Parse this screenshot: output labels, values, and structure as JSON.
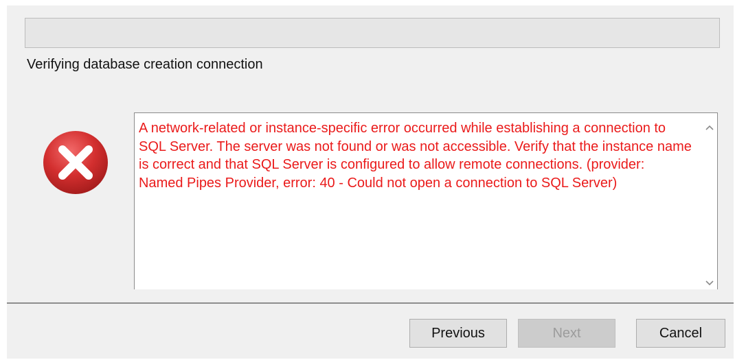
{
  "progress": {
    "value": 0
  },
  "status_text": "Verifying database creation connection",
  "error": {
    "icon": "error-x-icon",
    "icon_color": "#d32f2f",
    "text_color": "#ea1a1a",
    "message": "A network-related or instance-specific error occurred while establishing a connection to SQL Server. The server was not found or was not accessible. Verify that the instance name is correct and that SQL Server is configured to allow remote connections. (provider: Named Pipes Provider, error: 40 - Could not open a connection to SQL Server)"
  },
  "buttons": {
    "previous": "Previous",
    "next": "Next",
    "cancel": "Cancel"
  }
}
